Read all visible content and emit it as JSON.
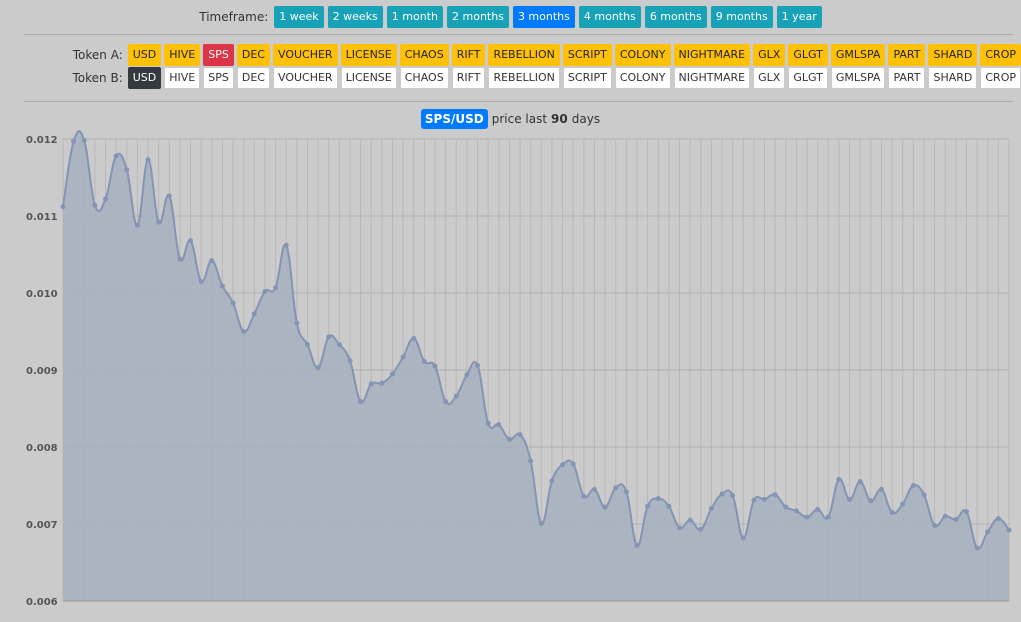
{
  "timeframe": {
    "label": "Timeframe:",
    "options": [
      "1 week",
      "2 weeks",
      "1 month",
      "2 months",
      "3 months",
      "4 months",
      "6 months",
      "9 months",
      "1 year"
    ],
    "selected": "3 months"
  },
  "tokens": {
    "list": [
      "USD",
      "HIVE",
      "SPS",
      "DEC",
      "VOUCHER",
      "LICENSE",
      "CHAOS",
      "RIFT",
      "REBELLION",
      "SCRIPT",
      "COLONY",
      "NIGHTMARE",
      "GLX",
      "GLGT",
      "GMLSPA",
      "PART",
      "SHARD",
      "CROP"
    ],
    "a_label": "Token A:",
    "b_label": "Token B:",
    "a_selected": "SPS",
    "b_selected": "USD"
  },
  "colors": {
    "info": "#17a2b8",
    "primary": "#007bff",
    "warning": "#ffc107",
    "danger": "#dc3545",
    "dark": "#343a40",
    "area_fill": "#a6b0c0",
    "line": "#8494b4"
  },
  "title": {
    "pair": "SPS/USD",
    "prefix": "price last",
    "days": "90",
    "suffix": "days"
  },
  "chart_data": {
    "type": "area",
    "ylim": [
      0.006,
      0.012
    ],
    "yticks": [
      "0.006",
      "0.007",
      "0.008",
      "0.009",
      "0.010",
      "0.011",
      "0.012"
    ],
    "grid": true,
    "series": [
      {
        "values": [
          0.01112,
          0.01197,
          0.01198,
          0.01114,
          0.01122,
          0.01178,
          0.0116,
          0.01088,
          0.01173,
          0.01092,
          0.01126,
          0.01044,
          0.01068,
          0.01015,
          0.01042,
          0.01009,
          0.00987,
          0.0095,
          0.00973,
          0.01002,
          0.01007,
          0.01062,
          0.00961,
          0.00933,
          0.00903,
          0.00943,
          0.00933,
          0.00912,
          0.00859,
          0.00882,
          0.00883,
          0.00895,
          0.00917,
          0.00941,
          0.00911,
          0.00905,
          0.00859,
          0.00866,
          0.00894,
          0.00906,
          0.00831,
          0.00829,
          0.0081,
          0.00816,
          0.00782,
          0.00701,
          0.00756,
          0.00777,
          0.00778,
          0.00736,
          0.00745,
          0.00722,
          0.00747,
          0.00742,
          0.00672,
          0.00723,
          0.00733,
          0.00723,
          0.00695,
          0.00705,
          0.00693,
          0.0072,
          0.00739,
          0.00737,
          0.00682,
          0.00731,
          0.00732,
          0.00738,
          0.00722,
          0.00717,
          0.00709,
          0.00719,
          0.00709,
          0.00758,
          0.00732,
          0.00755,
          0.0073,
          0.00745,
          0.00715,
          0.00726,
          0.0075,
          0.00738,
          0.00698,
          0.0071,
          0.00706,
          0.00716,
          0.00669,
          0.0069,
          0.00707,
          0.00692
        ]
      }
    ]
  }
}
